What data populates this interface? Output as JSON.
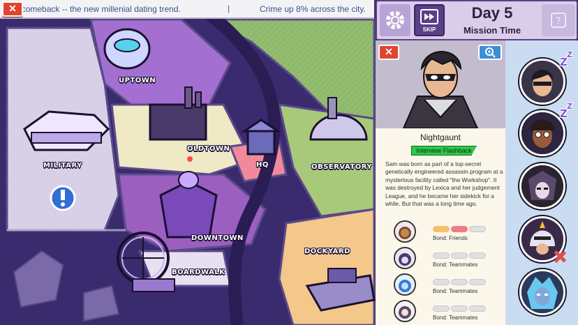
{
  "ticker": {
    "headline_1": "ng a comeback -- the new millenial dating trend.",
    "separator": "|",
    "headline_2": "Crime up 8% across the city."
  },
  "map": {
    "districts": {
      "uptown": "UPTOWN",
      "military": "MILITARY",
      "oldtown": "OLDTOWN",
      "hq": "HQ",
      "observatory": "OBSERVATORY",
      "downtown": "DOWNTOWN",
      "boardwalk": "BOARDWALK",
      "dockyard": "DOCKYARD"
    },
    "alert_icon": "exclamation-icon",
    "colors": {
      "water": "#3a2a6e",
      "district_purple": "#9b5fc0",
      "park_green": "#8fb96a",
      "hq_pink": "#f08a9a"
    }
  },
  "header": {
    "day": "Day 5",
    "phase": "Mission Time",
    "skip_label": "SKIP",
    "settings_icon": "gear-icon",
    "help_icon": "question-icon"
  },
  "profile": {
    "name": "Nightgaunt",
    "tag": "Interview Flashback",
    "bio": "Sam was born as part of a top-secret genetically engineered assassin program at a mysterious facility called \"the Workshop\". It was destroyed by Lexica and her judgement League, and he became her sidekick for a while. But that was a long time ago.",
    "bonds": [
      {
        "label": "Bond: Friends",
        "level": 2,
        "max": 3
      },
      {
        "label": "Bond: Teammates",
        "level": 0,
        "max": 3
      },
      {
        "label": "Bond: Teammates",
        "level": 0,
        "max": 3
      },
      {
        "label": "Bond: Teammates",
        "level": 0,
        "max": 3
      }
    ]
  },
  "roster": {
    "heroes": [
      {
        "name": "nightgaunt",
        "status": "sleeping"
      },
      {
        "name": "hero-2",
        "status": "sleeping"
      },
      {
        "name": "hero-3",
        "status": "available"
      },
      {
        "name": "hero-4",
        "status": "injured"
      },
      {
        "name": "hero-5",
        "status": "available"
      }
    ],
    "sleep_glyph": "Z"
  }
}
